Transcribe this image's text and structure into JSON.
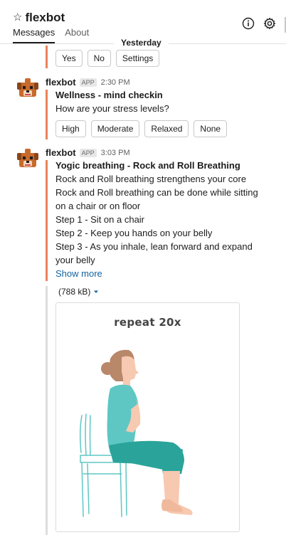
{
  "header": {
    "channel_name": "flexbot",
    "tabs": [
      {
        "label": "Messages",
        "active": true
      },
      {
        "label": "About",
        "active": false
      }
    ],
    "icons": [
      "info-icon",
      "gear-icon"
    ]
  },
  "date_divider": "Yesterday",
  "previous_buttons": [
    "Yes",
    "No",
    "Settings"
  ],
  "messages": [
    {
      "sender": "flexbot",
      "badge": "APP",
      "time": "2:30 PM",
      "attachment": {
        "accent": "#e8845b",
        "title": "Wellness - mind checkin",
        "text": "How are your stress levels?",
        "buttons": [
          "High",
          "Moderate",
          "Relaxed",
          "None"
        ]
      }
    },
    {
      "sender": "flexbot",
      "badge": "APP",
      "time": "3:03 PM",
      "attachment": {
        "accent": "#e8845b",
        "title": "Yogic breathing - Rock and Roll Breathing",
        "lines": [
          "Rock and Roll breathing strengthens your core",
          "Rock and Roll breathing can be done while sitting",
          "on a chair or on floor",
          "Step 1 - Sit on a chair",
          "Step 2 - Keep you hands on your belly",
          "Step 3 - As you inhale, lean forward and expand",
          "your belly"
        ],
        "show_more": "Show more"
      },
      "file": {
        "size": "(788 kB)",
        "image_caption": "repeat 20x"
      }
    }
  ],
  "colors": {
    "accent": "#e8845b",
    "link": "#1264a3",
    "shirt": "#5ec7c4",
    "pants": "#2aa39a",
    "hair": "#b9876a",
    "skin": "#f7c9b0"
  }
}
